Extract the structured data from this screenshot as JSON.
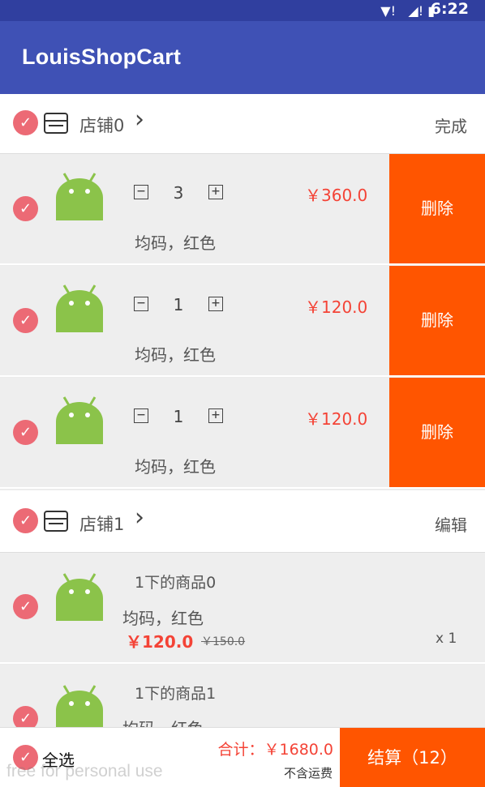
{
  "status_bar": {
    "time": "6:22"
  },
  "app_bar": {
    "title": "LouisShopCart"
  },
  "shops": [
    {
      "name": "店铺0",
      "action": "完成",
      "items": [
        {
          "qty": "3",
          "price": "￥360.0",
          "spec": "均码，红色",
          "delete_label": "删除"
        },
        {
          "qty": "1",
          "price": "￥120.0",
          "spec": "均码，红色",
          "delete_label": "删除"
        },
        {
          "qty": "1",
          "price": "￥120.0",
          "spec": "均码，红色",
          "delete_label": "删除"
        }
      ]
    },
    {
      "name": "店铺1",
      "action": "编辑",
      "items": [
        {
          "name": "1下的商品0",
          "spec": "均码，红色",
          "price": "￥120.0",
          "old_price": "￥150.0",
          "count": "x 1"
        },
        {
          "name": "1下的商品1",
          "spec": "均码，红色"
        }
      ]
    }
  ],
  "bottom_bar": {
    "select_all": "全选",
    "total": "合计：￥1680.0",
    "shipping": "不含运费",
    "checkout": "结算（12）"
  },
  "watermark": "free for personal use",
  "colors": {
    "primary": "#3f51b5",
    "primary_dark": "#303f9f",
    "accent": "#ff5500",
    "price": "#f44336",
    "check": "#ec6a75"
  }
}
